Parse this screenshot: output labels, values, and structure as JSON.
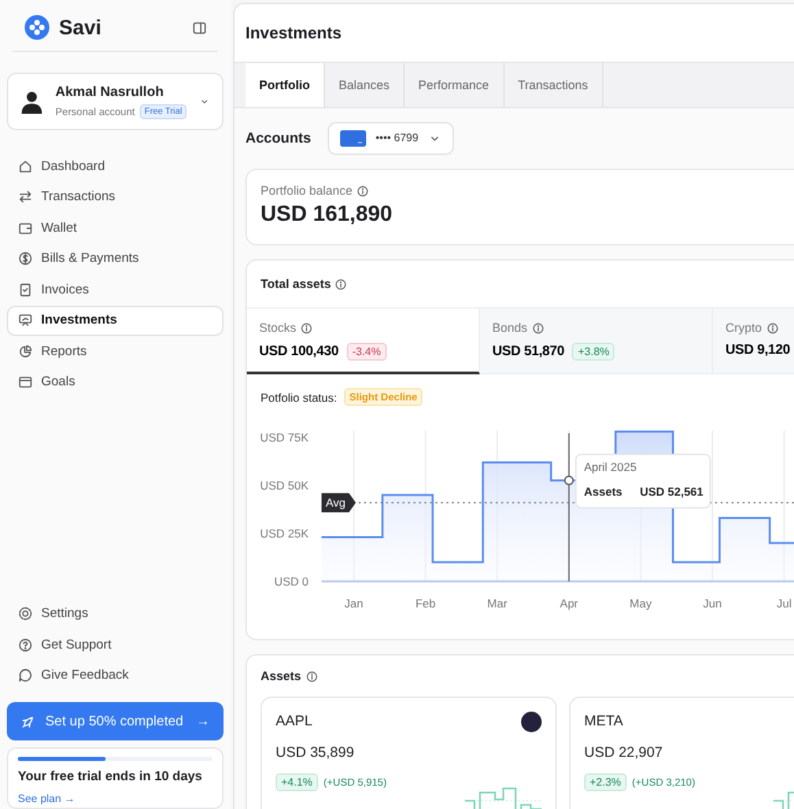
{
  "brand": {
    "name": "Savi"
  },
  "account": {
    "name": "Akmal Nasrulloh",
    "type": "Personal account",
    "badge": "Free Trial"
  },
  "nav": [
    {
      "label": "Dashboard",
      "selected": false
    },
    {
      "label": "Transactions",
      "selected": false
    },
    {
      "label": "Wallet",
      "selected": false
    },
    {
      "label": "Bills & Payments",
      "selected": false
    },
    {
      "label": "Invoices",
      "selected": false
    },
    {
      "label": "Investments",
      "selected": true
    },
    {
      "label": "Reports",
      "selected": false
    },
    {
      "label": "Goals",
      "selected": false
    }
  ],
  "footer_nav": [
    {
      "label": "Settings"
    },
    {
      "label": "Get Support"
    },
    {
      "label": "Give Feedback"
    }
  ],
  "setup": {
    "label": "Set up 50% completed",
    "arrow": "→"
  },
  "trial": {
    "level": 0.45,
    "text": "Your free trial ends in 10 days",
    "link": "See plan",
    "link_arrow": "→"
  },
  "page": {
    "title": "Investments"
  },
  "tabs": [
    {
      "label": "Portfolio",
      "selected": true
    },
    {
      "label": "Balances",
      "selected": false
    },
    {
      "label": "Performance",
      "selected": false
    },
    {
      "label": "Transactions",
      "selected": false
    }
  ],
  "accounts": {
    "label": "Accounts",
    "card": "•••• 6799"
  },
  "balance": {
    "label": "Portfolio balance",
    "value": "USD 161,890"
  },
  "total_assets": {
    "title": "Total assets",
    "classes": [
      {
        "label": "Stocks",
        "value": "USD 100,430",
        "change": "-3.4%",
        "negative": true,
        "selected": true
      },
      {
        "label": "Bonds",
        "value": "USD 51,870",
        "change": "+3.8%",
        "negative": false,
        "selected": false
      },
      {
        "label": "Crypto",
        "value": "USD 9,120",
        "selected": false
      }
    ],
    "status_label": "Potfolio status:",
    "status": "Slight Decline",
    "chart": {
      "y_labels": [
        "USD 75K",
        "USD 50K",
        "USD 25K",
        "USD 0"
      ],
      "x_labels": [
        "Jan",
        "Feb",
        "Mar",
        "Apr",
        "May",
        "Jun",
        "Jul"
      ],
      "avg_label": "Avg",
      "tooltip": {
        "title": "April 2025",
        "label": "Assets",
        "value": "USD 52,561"
      }
    }
  },
  "assets": {
    "title": "Assets",
    "items": [
      {
        "ticker": "AAPL",
        "value": "USD 35,899",
        "change": "+4.1%",
        "delta": "(+USD 5,915)"
      },
      {
        "ticker": "META",
        "value": "USD 22,907",
        "change": "+2.3%",
        "delta": "(+USD 3,210)"
      }
    ]
  }
}
